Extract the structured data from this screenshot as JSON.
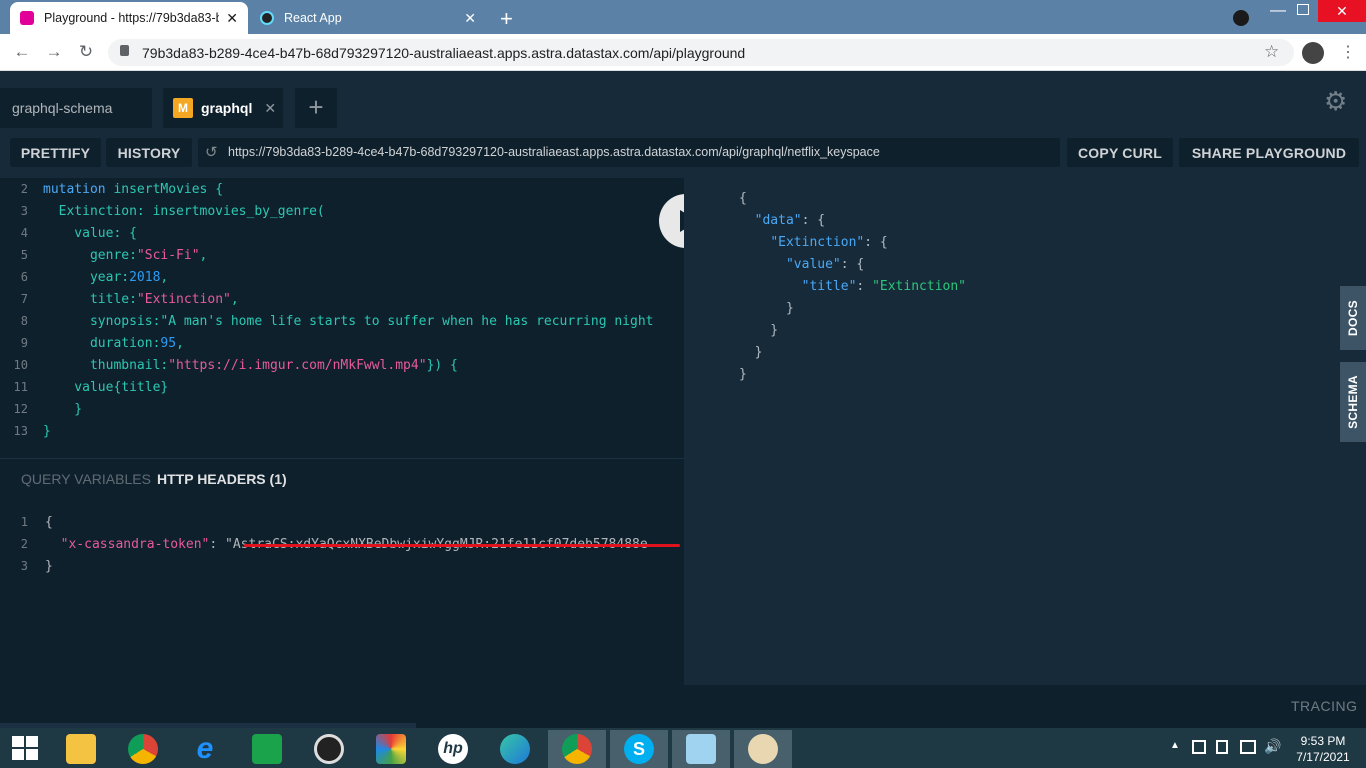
{
  "browser": {
    "tabs": [
      {
        "title": "Playground - https://79b3da83-b",
        "active": true
      },
      {
        "title": "React App",
        "active": false
      }
    ],
    "url": "79b3da83-b289-4ce4-b47b-68d793297120-australiaeast.apps.astra.datastax.com/api/playground"
  },
  "playground": {
    "tabs": [
      {
        "label": "graphql-schema"
      },
      {
        "label": "graphql",
        "badge": "M"
      }
    ],
    "toolbar": {
      "prettify": "PRETTIFY",
      "history": "HISTORY",
      "endpoint": "https://79b3da83-b289-4ce4-b47b-68d793297120-australiaeast.apps.astra.datastax.com/api/graphql/netflix_keyspace",
      "copy_curl": "COPY CURL",
      "share": "SHARE PLAYGROUND"
    },
    "editor_lines": [
      {
        "n": "2",
        "text": "mutation insertMovies {"
      },
      {
        "n": "3",
        "text": "  Extinction: insertmovies_by_genre("
      },
      {
        "n": "4",
        "text": "    value: {"
      },
      {
        "n": "5",
        "text": "      genre:\"Sci-Fi\","
      },
      {
        "n": "6",
        "text": "      year:2018,"
      },
      {
        "n": "7",
        "text": "      title:\"Extinction\","
      },
      {
        "n": "8",
        "text": "      synopsis:\"A man's home life starts to suffer when he has recurring night"
      },
      {
        "n": "9",
        "text": "      duration:95,"
      },
      {
        "n": "10",
        "text": "      thumbnail:\"https://i.imgur.com/nMkFwwl.mp4\"}) {"
      },
      {
        "n": "11",
        "text": "    value{title}"
      },
      {
        "n": "12",
        "text": "    }"
      },
      {
        "n": "13",
        "text": "}"
      }
    ],
    "result_lines": [
      "{",
      "  \"data\": {",
      "    \"Extinction\": {",
      "      \"value\": {",
      "        \"title\": \"Extinction\"",
      "      }",
      "    }",
      "  }",
      "}"
    ],
    "bottom_tabs": {
      "variables": "QUERY VARIABLES",
      "headers": "HTTP HEADERS (1)"
    },
    "headers_lines": [
      {
        "n": "1",
        "text": "{"
      },
      {
        "n": "2",
        "text": "  \"x-cassandra-token\": \"AstraCS:xdYaQcxNXBeDbwjxiwYggMJR:21fe11cf07deb578488e"
      },
      {
        "n": "3",
        "text": "}"
      }
    ],
    "side_tabs": {
      "docs": "DOCS",
      "schema": "SCHEMA"
    },
    "tracing": "TRACING"
  },
  "taskbar": {
    "time": "9:53 PM",
    "date": "7/17/2021"
  }
}
